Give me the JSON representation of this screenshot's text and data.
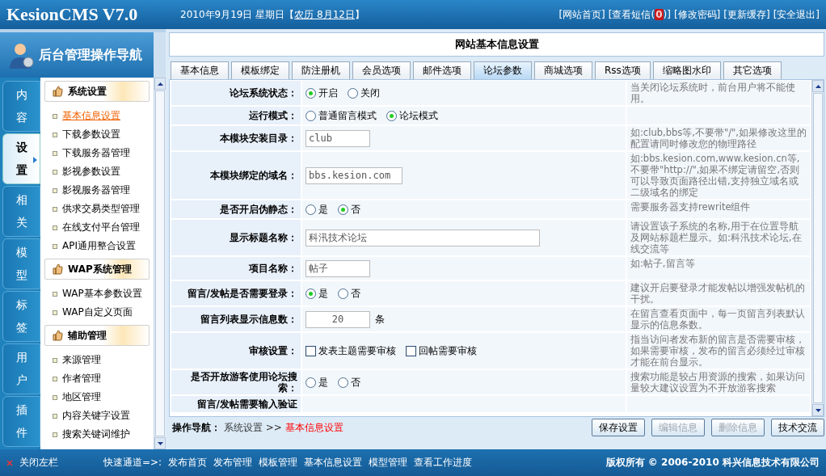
{
  "header": {
    "logo": "KesionCMS V7.0",
    "date": "2010年9月19日 星期日【",
    "lunar": "农历 8月12日",
    "date_end": "】",
    "links": [
      {
        "label": "[网站首页]"
      },
      {
        "label": "[查看短信(",
        "count": "0",
        "suffix": ")]"
      },
      {
        "label": "[修改密码]"
      },
      {
        "label": "[更新缓存]"
      },
      {
        "label": "[安全退出]"
      }
    ]
  },
  "sidebar": {
    "title": "后台管理操作导航",
    "tabs": [
      {
        "label": "内容",
        "selected": false
      },
      {
        "label": "设置",
        "selected": true
      },
      {
        "label": "相关",
        "selected": false
      },
      {
        "label": "模型",
        "selected": false
      },
      {
        "label": "标签",
        "selected": false
      },
      {
        "label": "用户",
        "selected": false
      },
      {
        "label": "插件",
        "selected": false
      }
    ],
    "groups": [
      {
        "title": "系统设置",
        "items": [
          {
            "label": "基本信息设置",
            "selected": true
          },
          {
            "label": "下载参数设置",
            "selected": false
          },
          {
            "label": "下载服务器管理",
            "selected": false
          },
          {
            "label": "影视参数设置",
            "selected": false
          },
          {
            "label": "影视服务器管理",
            "selected": false
          },
          {
            "label": "供求交易类型管理",
            "selected": false
          },
          {
            "label": "在线支付平台管理",
            "selected": false
          },
          {
            "label": "API通用整合设置",
            "selected": false
          }
        ]
      },
      {
        "title": "WAP系统管理",
        "items": [
          {
            "label": "WAP基本参数设置",
            "selected": false
          },
          {
            "label": "WAP自定义页面",
            "selected": false
          }
        ]
      },
      {
        "title": "辅助管理",
        "items": [
          {
            "label": "来源管理",
            "selected": false
          },
          {
            "label": "作者管理",
            "selected": false
          },
          {
            "label": "地区管理",
            "selected": false
          },
          {
            "label": "内容关键字设置",
            "selected": false
          },
          {
            "label": "搜索关键词维护",
            "selected": false
          }
        ]
      }
    ]
  },
  "main": {
    "title": "网站基本信息设置",
    "tabs": [
      {
        "label": "基本信息",
        "selected": false
      },
      {
        "label": "模板绑定",
        "selected": false
      },
      {
        "label": "防注册机",
        "selected": false
      },
      {
        "label": "会员选项",
        "selected": false
      },
      {
        "label": "邮件选项",
        "selected": false
      },
      {
        "label": "论坛参数",
        "selected": true
      },
      {
        "label": "商城选项",
        "selected": false
      },
      {
        "label": "Rss选项",
        "selected": false
      },
      {
        "label": "缩略图水印",
        "selected": false
      },
      {
        "label": "其它选项",
        "selected": false
      }
    ],
    "rows": [
      {
        "label": "论坛系统状态：",
        "kind": "radio",
        "options": [
          {
            "label": "开启",
            "selected": true
          },
          {
            "label": "关闭",
            "selected": false
          }
        ],
        "hint": "当关闭论坛系统时，前台用户将不能使用。"
      },
      {
        "label": "运行模式：",
        "kind": "radio",
        "options": [
          {
            "label": "普通留言模式",
            "selected": false
          },
          {
            "label": "论坛模式",
            "selected": true
          }
        ]
      },
      {
        "label": "本模块安装目录：",
        "kind": "text",
        "value": "club",
        "hint": "如:club,bbs等,不要带\"/\",如果修改这里的配置请同时修改您的物理路径"
      },
      {
        "label": "本模块绑定的域名：",
        "kind": "text",
        "value": "bbs.kesion.com",
        "hint": "如:bbs.kesion.com,www.kesion.cn等,不要带\"http://\",如果不绑定请留空,否则可以导致页面路径出错,支持独立域名或二级域名的绑定"
      },
      {
        "label": "是否开启伪静态：",
        "kind": "radio",
        "options": [
          {
            "label": "是",
            "selected": false
          },
          {
            "label": "否",
            "selected": true
          }
        ],
        "hint": "需要服务器支持rewrite组件"
      },
      {
        "label": "显示标题名称：",
        "kind": "wide",
        "value": "科汛技术论坛",
        "hint": "请设置该子系统的名称,用于在位置导航及网站标题栏显示。如:科汛技术论坛,在线交流等"
      },
      {
        "label": "项目名称：",
        "kind": "text",
        "value": "帖子",
        "hint": "如:帖子,留言等"
      },
      {
        "label": "留言/发帖是否需要登录：",
        "kind": "radio",
        "options": [
          {
            "label": "是",
            "selected": true
          },
          {
            "label": "否",
            "selected": false
          }
        ],
        "hint": "建议开启要登录才能发帖以增强发帖机的干扰。"
      },
      {
        "label": "留言列表显示信息数：",
        "kind": "number",
        "value": "20",
        "unit": "条",
        "hint": "在留言查看页面中，每一页留言列表默认显示的信息条数。"
      },
      {
        "label": "审核设置：",
        "kind": "checkbox",
        "options": [
          {
            "label": "发表主题需要审核",
            "checked": false
          },
          {
            "label": "回帖需要审核",
            "checked": false
          }
        ],
        "hint": "指当访问者发布新的留言是否需要审核，如果需要审核，发布的留言必须经过审核才能在前台显示。"
      },
      {
        "label": "是否开放游客使用论坛搜索：",
        "kind": "radio",
        "options": [
          {
            "label": "是",
            "selected": false
          },
          {
            "label": "否",
            "selected": false
          }
        ],
        "hint": "搜索功能是较占用资源的搜索，如果访问量较大建议设置为不开放游客搜索"
      },
      {
        "label": "留言/发帖需要输入验证",
        "kind": "cut"
      }
    ],
    "crumb": {
      "label": "操作导航：",
      "path": "系统设置 >> ",
      "current": "基本信息设置"
    },
    "buttons": [
      {
        "label": "保存设置",
        "disabled": false
      },
      {
        "label": "编辑信息",
        "disabled": true
      },
      {
        "label": "删除信息",
        "disabled": true
      },
      {
        "label": "技术交流",
        "disabled": false
      }
    ]
  },
  "footer": {
    "close": "关闭左栏",
    "quick": "快速通道=>:",
    "links": [
      "发布首页",
      "发布管理",
      "模板管理",
      "基本信息设置",
      "模型管理",
      "查看工作进度"
    ],
    "copyright": "版权所有 © 2006-2010 科兴信息技术有限公司"
  }
}
